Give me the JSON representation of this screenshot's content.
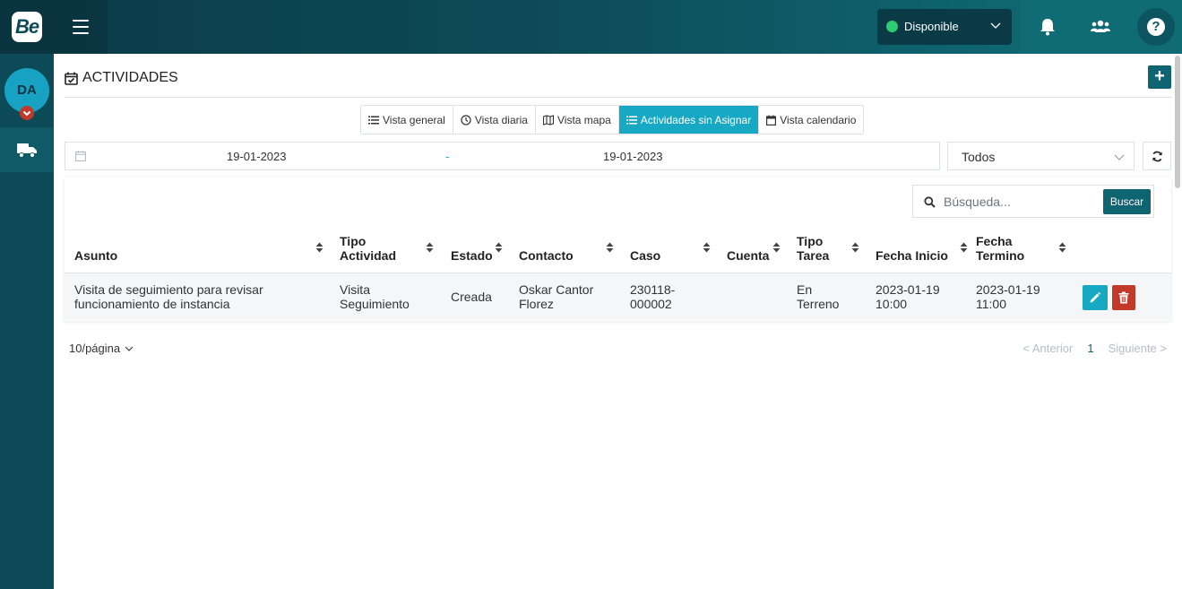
{
  "app": {
    "logo_text": "Be"
  },
  "topbar": {
    "status": {
      "label": "Disponible",
      "color": "#2ecc71"
    },
    "icons": [
      "menu-icon",
      "bell-icon",
      "users-icon",
      "help-icon"
    ],
    "help_glyph": "?"
  },
  "sidebar": {
    "avatar_initials": "DA",
    "items": [
      {
        "icon": "truck-icon"
      }
    ]
  },
  "page": {
    "title": "ACTIVIDADES",
    "add_label": "+",
    "tabs": [
      {
        "label": "Vista general",
        "icon": "list-icon",
        "active": false
      },
      {
        "label": "Vista diaria",
        "icon": "clock-icon",
        "active": false
      },
      {
        "label": "Vista mapa",
        "icon": "map-icon",
        "active": false
      },
      {
        "label": "Actividades sin Asignar",
        "icon": "list-icon",
        "active": true
      },
      {
        "label": "Vista calendario",
        "icon": "calendar-icon",
        "active": false
      }
    ]
  },
  "filters": {
    "date_start": "19-01-2023",
    "date_separator": "-",
    "date_end": "19-01-2023",
    "select_value": "Todos"
  },
  "search": {
    "placeholder": "Búsqueda...",
    "button_label": "Buscar"
  },
  "table": {
    "columns": {
      "asunto": "Asunto",
      "tipo_actividad_1": "Tipo",
      "tipo_actividad_2": "Actividad",
      "estado": "Estado",
      "contacto": "Contacto",
      "caso": "Caso",
      "cuenta": "Cuenta",
      "tipo_tarea_1": "Tipo",
      "tipo_tarea_2": "Tarea",
      "fecha_inicio": "Fecha Inicio",
      "fecha_termino_1": "Fecha",
      "fecha_termino_2": "Termino"
    },
    "rows": [
      {
        "asunto_1": "Visita de seguimiento para revisar",
        "asunto_2": "funcionamiento de instancia",
        "tipo_actividad_1": "Visita",
        "tipo_actividad_2": "Seguimiento",
        "estado": "Creada",
        "contacto_1": "Oskar Cantor",
        "contacto_2": "Florez",
        "caso_1": "230118-",
        "caso_2": "000002",
        "cuenta": "",
        "tipo_tarea_1": "En",
        "tipo_tarea_2": "Terreno",
        "fecha_inicio_1": "2023-01-19",
        "fecha_inicio_2": "10:00",
        "fecha_termino_1": "2023-01-19",
        "fecha_termino_2": "11:00"
      }
    ]
  },
  "pagination": {
    "page_size": "10/página",
    "prev": "< Anterior",
    "current": "1",
    "next": "Siguiente >"
  },
  "colors": {
    "accent": "#17a9c4",
    "primary": "#0e6470",
    "danger": "#c0392b",
    "sidebar": "#0d4a57"
  }
}
